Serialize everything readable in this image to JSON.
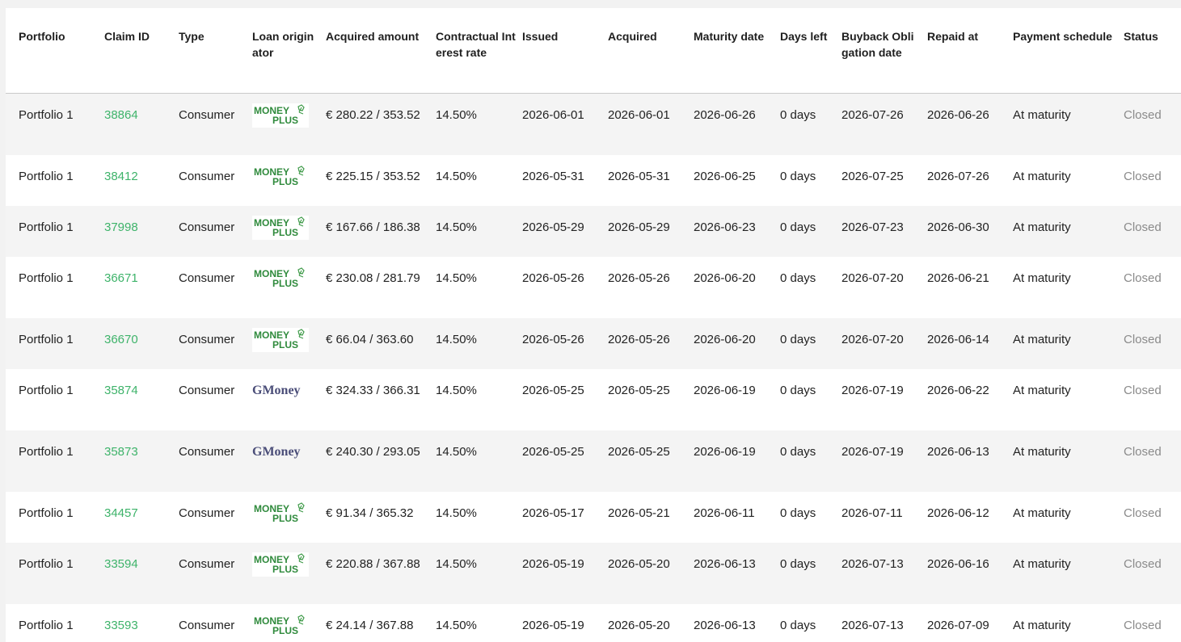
{
  "table": {
    "headers": {
      "portfolio": "Portfolio",
      "claim_id": "Claim ID",
      "type": "Type",
      "loan_originator": "Loan originator",
      "acquired_amount": "Acquired amount",
      "interest_rate": "Contractual Interest rate",
      "issued": "Issued",
      "acquired": "Acquired",
      "maturity_date": "Maturity date",
      "days_left": "Days left",
      "buyback_date": "Buyback Obligation date",
      "repaid_at": "Repaid at",
      "payment_schedule": "Payment schedule",
      "status": "Status"
    },
    "rows": [
      {
        "portfolio": "Portfolio 1",
        "claim_id": "38864",
        "type": "Consumer",
        "originator": "MONEY PLUS",
        "amount": "€ 280.22 / 353.52",
        "rate": "14.50%",
        "issued": "2026-06-01",
        "acquired": "2026-06-01",
        "maturity": "2026-06-26",
        "days_left": "0 days",
        "buyback": "2026-07-26",
        "repaid": "2026-06-26",
        "schedule": "At maturity",
        "status": "Closed"
      },
      {
        "portfolio": "Portfolio 1",
        "claim_id": "38412",
        "type": "Consumer",
        "originator": "MONEY PLUS",
        "amount": "€ 225.15 / 353.52",
        "rate": "14.50%",
        "issued": "2026-05-31",
        "acquired": "2026-05-31",
        "maturity": "2026-06-25",
        "days_left": "0 days",
        "buyback": "2026-07-25",
        "repaid": "2026-07-26",
        "schedule": "At maturity",
        "status": "Closed"
      },
      {
        "portfolio": "Portfolio 1",
        "claim_id": "37998",
        "type": "Consumer",
        "originator": "MONEY PLUS",
        "amount": "€ 167.66 / 186.38",
        "rate": "14.50%",
        "issued": "2026-05-29",
        "acquired": "2026-05-29",
        "maturity": "2026-06-23",
        "days_left": "0 days",
        "buyback": "2026-07-23",
        "repaid": "2026-06-30",
        "schedule": "At maturity",
        "status": "Closed"
      },
      {
        "portfolio": "Portfolio 1",
        "claim_id": "36671",
        "type": "Consumer",
        "originator": "MONEY PLUS",
        "amount": "€ 230.08 / 281.79",
        "rate": "14.50%",
        "issued": "2026-05-26",
        "acquired": "2026-05-26",
        "maturity": "2026-06-20",
        "days_left": "0 days",
        "buyback": "2026-07-20",
        "repaid": "2026-06-21",
        "schedule": "At maturity",
        "status": "Closed"
      },
      {
        "portfolio": "Portfolio 1",
        "claim_id": "36670",
        "type": "Consumer",
        "originator": "MONEY PLUS",
        "amount": "€ 66.04 / 363.60",
        "rate": "14.50%",
        "issued": "2026-05-26",
        "acquired": "2026-05-26",
        "maturity": "2026-06-20",
        "days_left": "0 days",
        "buyback": "2026-07-20",
        "repaid": "2026-06-14",
        "schedule": "At maturity",
        "status": "Closed"
      },
      {
        "portfolio": "Portfolio 1",
        "claim_id": "35874",
        "type": "Consumer",
        "originator": "GMoney",
        "amount": "€ 324.33 / 366.31",
        "rate": "14.50%",
        "issued": "2026-05-25",
        "acquired": "2026-05-25",
        "maturity": "2026-06-19",
        "days_left": "0 days",
        "buyback": "2026-07-19",
        "repaid": "2026-06-22",
        "schedule": "At maturity",
        "status": "Closed"
      },
      {
        "portfolio": "Portfolio 1",
        "claim_id": "35873",
        "type": "Consumer",
        "originator": "GMoney",
        "amount": "€ 240.30 / 293.05",
        "rate": "14.50%",
        "issued": "2026-05-25",
        "acquired": "2026-05-25",
        "maturity": "2026-06-19",
        "days_left": "0 days",
        "buyback": "2026-07-19",
        "repaid": "2026-06-13",
        "schedule": "At maturity",
        "status": "Closed"
      },
      {
        "portfolio": "Portfolio 1",
        "claim_id": "34457",
        "type": "Consumer",
        "originator": "MONEY PLUS",
        "amount": "€ 91.34 / 365.32",
        "rate": "14.50%",
        "issued": "2026-05-17",
        "acquired": "2026-05-21",
        "maturity": "2026-06-11",
        "days_left": "0 days",
        "buyback": "2026-07-11",
        "repaid": "2026-06-12",
        "schedule": "At maturity",
        "status": "Closed"
      },
      {
        "portfolio": "Portfolio 1",
        "claim_id": "33594",
        "type": "Consumer",
        "originator": "MONEY PLUS",
        "amount": "€ 220.88 / 367.88",
        "rate": "14.50%",
        "issued": "2026-05-19",
        "acquired": "2026-05-20",
        "maturity": "2026-06-13",
        "days_left": "0 days",
        "buyback": "2026-07-13",
        "repaid": "2026-06-16",
        "schedule": "At maturity",
        "status": "Closed"
      },
      {
        "portfolio": "Portfolio 1",
        "claim_id": "33593",
        "type": "Consumer",
        "originator": "MONEY PLUS",
        "amount": "€ 24.14 / 367.88",
        "rate": "14.50%",
        "issued": "2026-05-19",
        "acquired": "2026-05-20",
        "maturity": "2026-06-13",
        "days_left": "0 days",
        "buyback": "2026-07-13",
        "repaid": "2026-07-09",
        "schedule": "At maturity",
        "status": "Closed"
      }
    ]
  },
  "colors": {
    "link": "#3eb36a",
    "status_closed": "#8a8a8a",
    "moneyplus_brand": "#2f8a3c",
    "gmoney_brand": "#4a4d78"
  }
}
